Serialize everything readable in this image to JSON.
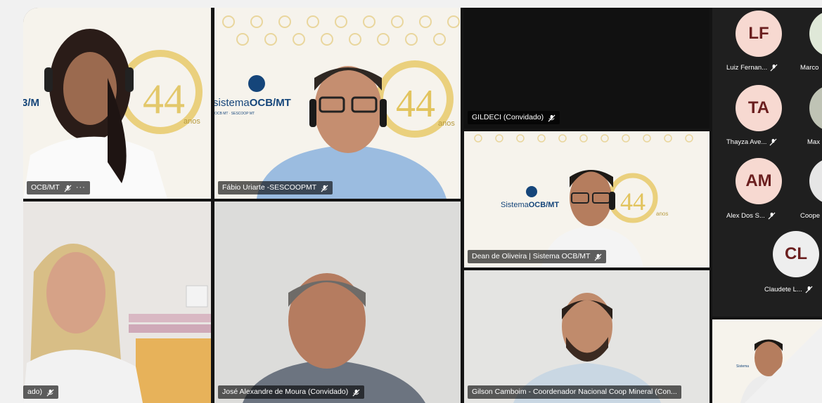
{
  "participants": [
    {
      "name": "OCB/MT",
      "more": "···"
    },
    {
      "name": "Fábio Uriarte -SESCOOPMT"
    },
    {
      "name": "GILDECI (Convidado)"
    },
    {
      "name": "Dean de Oliveira | Sistema OCB/MT"
    },
    {
      "name": "ado)"
    },
    {
      "name": "José Alexandre de Moura (Convidado)"
    },
    {
      "name": "Gilson Camboim - Coordenador Nacional Coop Mineral (Con..."
    }
  ],
  "branding": {
    "logo_sistema": "Sistema",
    "logo_ocbmt": "OCB/MT",
    "logo_sub": "OCB MT · SESCOOP MT",
    "years": "44",
    "years_word": "anos"
  },
  "gallery": [
    {
      "initials": "LF",
      "name": "Luiz Fernan...",
      "color": "#f7d9d1"
    },
    {
      "initials": "",
      "name": "Marco",
      "color": "#dfe8d8"
    },
    {
      "initials": "TA",
      "name": "Thayza Ave...",
      "color": "#f7d9d1"
    },
    {
      "initials": "",
      "name": "Max",
      "color": "#cfcfcf"
    },
    {
      "initials": "AM",
      "name": "Alex Dos S...",
      "color": "#f7d9d1"
    },
    {
      "initials": "",
      "name": "Coope",
      "color": "#e6e6e6"
    },
    {
      "initials": "CL",
      "name": "Claudete L...",
      "color": "#eeeeee"
    }
  ]
}
